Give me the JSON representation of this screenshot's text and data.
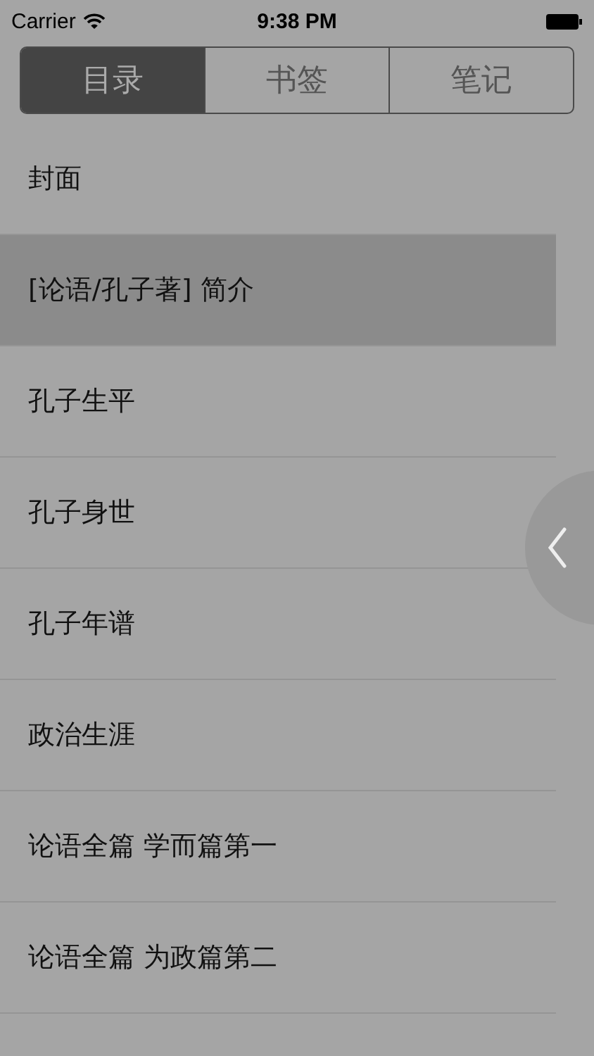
{
  "status_bar": {
    "carrier": "Carrier",
    "time": "9:38 PM"
  },
  "tabs": [
    {
      "label": "目录",
      "selected": true
    },
    {
      "label": "书签",
      "selected": false
    },
    {
      "label": "笔记",
      "selected": false
    }
  ],
  "items": [
    {
      "title": "封面",
      "selected": false
    },
    {
      "title": "[论语/孔子著] 简介",
      "selected": true
    },
    {
      "title": "孔子生平",
      "selected": false
    },
    {
      "title": "孔子身世",
      "selected": false
    },
    {
      "title": "孔子年谱",
      "selected": false
    },
    {
      "title": "政治生涯",
      "selected": false
    },
    {
      "title": "论语全篇 学而篇第一",
      "selected": false
    },
    {
      "title": "论语全篇 为政篇第二",
      "selected": false
    }
  ]
}
